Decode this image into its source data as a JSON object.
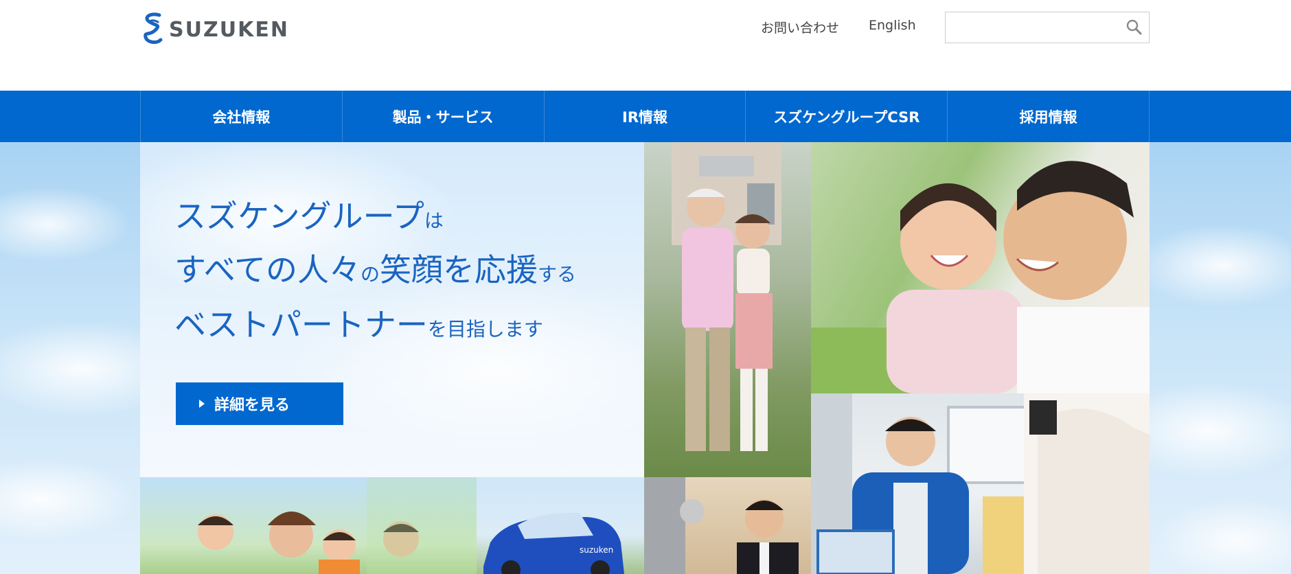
{
  "header": {
    "logo_text": "SUZUKEN",
    "util_links": {
      "contact": "お問い合わせ",
      "english": "English"
    },
    "search": {
      "value": "",
      "placeholder": "",
      "icon": "search-icon"
    }
  },
  "nav": {
    "items": [
      {
        "label": "会社情報"
      },
      {
        "label": "製品・サービス"
      },
      {
        "label": "IR情報"
      },
      {
        "label": "スズケングループCSR"
      },
      {
        "label": "採用情報"
      }
    ]
  },
  "hero": {
    "line1": {
      "big": "スズケングループ",
      "small": "は"
    },
    "line2": {
      "big1": "すべての人々",
      "small1": "の",
      "big2": "笑顔を応援",
      "small2": "する"
    },
    "line3": {
      "big": "ベストパートナー",
      "small": "を目指します"
    },
    "cta_label": "詳細を見る"
  },
  "colors": {
    "brand_blue": "#0068cf",
    "headline_blue": "#1a64c0"
  }
}
